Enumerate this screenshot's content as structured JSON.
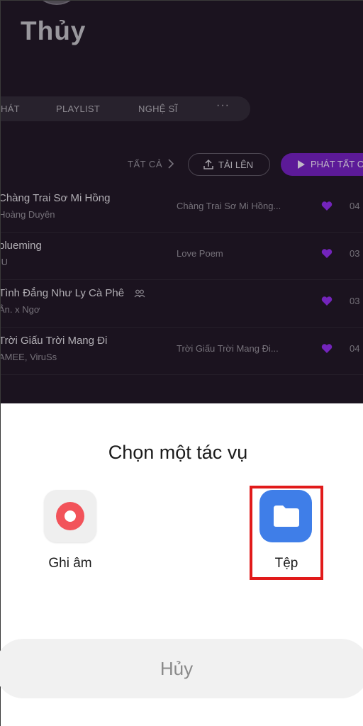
{
  "profile": {
    "name": "Thủy"
  },
  "tabs": [
    {
      "label": "HÁT"
    },
    {
      "label": "PLAYLIST"
    },
    {
      "label": "NGHỆ SĨ"
    },
    {
      "label": "···"
    }
  ],
  "toolbar": {
    "filter_label": "TẤT CẢ",
    "upload_label": "TẢI LÊN",
    "play_all_label": "PHÁT TẤT C"
  },
  "songs": [
    {
      "title": "Chàng Trai Sơ Mi Hồng",
      "artist": "Hoàng Duyên",
      "album": "Chàng Trai Sơ Mi Hồng...",
      "duration": "04"
    },
    {
      "title": "blueming",
      "artist": "IU",
      "album": "Love Poem",
      "duration": "03"
    },
    {
      "title": "Tình Đắng Như Ly Cà Phê",
      "artist": "Ân. x Ngơ",
      "album": "",
      "duration": "03"
    },
    {
      "title": "Trời Giấu Trời Mang Đi",
      "artist": "AMEE, ViruSs",
      "album": "Trời Giấu Trời Mang Đi...",
      "duration": "04"
    }
  ],
  "sheet": {
    "title": "Chọn một tác vụ",
    "options": [
      {
        "label": "Ghi âm",
        "icon": "recorder-icon"
      },
      {
        "label": "Tệp",
        "icon": "folder-icon"
      }
    ],
    "cancel_label": "Hủy"
  },
  "colors": {
    "accent_purple": "#6e1fb8",
    "heart": "#8a2be2",
    "highlight": "#e11a1a",
    "files_blue": "#3f7ee8",
    "recorder_red": "#f2535a"
  }
}
